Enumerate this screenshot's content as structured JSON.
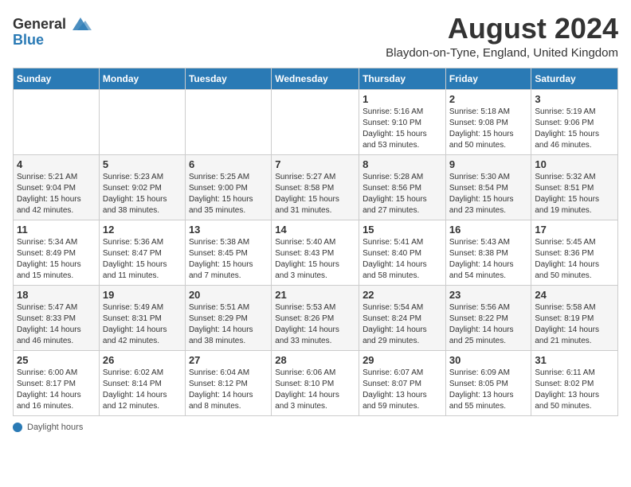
{
  "header": {
    "logo_general": "General",
    "logo_blue": "Blue",
    "month_year": "August 2024",
    "location": "Blaydon-on-Tyne, England, United Kingdom"
  },
  "calendar": {
    "days_of_week": [
      "Sunday",
      "Monday",
      "Tuesday",
      "Wednesday",
      "Thursday",
      "Friday",
      "Saturday"
    ],
    "weeks": [
      [
        {
          "day": "",
          "info": ""
        },
        {
          "day": "",
          "info": ""
        },
        {
          "day": "",
          "info": ""
        },
        {
          "day": "",
          "info": ""
        },
        {
          "day": "1",
          "info": "Sunrise: 5:16 AM\nSunset: 9:10 PM\nDaylight: 15 hours\nand 53 minutes."
        },
        {
          "day": "2",
          "info": "Sunrise: 5:18 AM\nSunset: 9:08 PM\nDaylight: 15 hours\nand 50 minutes."
        },
        {
          "day": "3",
          "info": "Sunrise: 5:19 AM\nSunset: 9:06 PM\nDaylight: 15 hours\nand 46 minutes."
        }
      ],
      [
        {
          "day": "4",
          "info": "Sunrise: 5:21 AM\nSunset: 9:04 PM\nDaylight: 15 hours\nand 42 minutes."
        },
        {
          "day": "5",
          "info": "Sunrise: 5:23 AM\nSunset: 9:02 PM\nDaylight: 15 hours\nand 38 minutes."
        },
        {
          "day": "6",
          "info": "Sunrise: 5:25 AM\nSunset: 9:00 PM\nDaylight: 15 hours\nand 35 minutes."
        },
        {
          "day": "7",
          "info": "Sunrise: 5:27 AM\nSunset: 8:58 PM\nDaylight: 15 hours\nand 31 minutes."
        },
        {
          "day": "8",
          "info": "Sunrise: 5:28 AM\nSunset: 8:56 PM\nDaylight: 15 hours\nand 27 minutes."
        },
        {
          "day": "9",
          "info": "Sunrise: 5:30 AM\nSunset: 8:54 PM\nDaylight: 15 hours\nand 23 minutes."
        },
        {
          "day": "10",
          "info": "Sunrise: 5:32 AM\nSunset: 8:51 PM\nDaylight: 15 hours\nand 19 minutes."
        }
      ],
      [
        {
          "day": "11",
          "info": "Sunrise: 5:34 AM\nSunset: 8:49 PM\nDaylight: 15 hours\nand 15 minutes."
        },
        {
          "day": "12",
          "info": "Sunrise: 5:36 AM\nSunset: 8:47 PM\nDaylight: 15 hours\nand 11 minutes."
        },
        {
          "day": "13",
          "info": "Sunrise: 5:38 AM\nSunset: 8:45 PM\nDaylight: 15 hours\nand 7 minutes."
        },
        {
          "day": "14",
          "info": "Sunrise: 5:40 AM\nSunset: 8:43 PM\nDaylight: 15 hours\nand 3 minutes."
        },
        {
          "day": "15",
          "info": "Sunrise: 5:41 AM\nSunset: 8:40 PM\nDaylight: 14 hours\nand 58 minutes."
        },
        {
          "day": "16",
          "info": "Sunrise: 5:43 AM\nSunset: 8:38 PM\nDaylight: 14 hours\nand 54 minutes."
        },
        {
          "day": "17",
          "info": "Sunrise: 5:45 AM\nSunset: 8:36 PM\nDaylight: 14 hours\nand 50 minutes."
        }
      ],
      [
        {
          "day": "18",
          "info": "Sunrise: 5:47 AM\nSunset: 8:33 PM\nDaylight: 14 hours\nand 46 minutes."
        },
        {
          "day": "19",
          "info": "Sunrise: 5:49 AM\nSunset: 8:31 PM\nDaylight: 14 hours\nand 42 minutes."
        },
        {
          "day": "20",
          "info": "Sunrise: 5:51 AM\nSunset: 8:29 PM\nDaylight: 14 hours\nand 38 minutes."
        },
        {
          "day": "21",
          "info": "Sunrise: 5:53 AM\nSunset: 8:26 PM\nDaylight: 14 hours\nand 33 minutes."
        },
        {
          "day": "22",
          "info": "Sunrise: 5:54 AM\nSunset: 8:24 PM\nDaylight: 14 hours\nand 29 minutes."
        },
        {
          "day": "23",
          "info": "Sunrise: 5:56 AM\nSunset: 8:22 PM\nDaylight: 14 hours\nand 25 minutes."
        },
        {
          "day": "24",
          "info": "Sunrise: 5:58 AM\nSunset: 8:19 PM\nDaylight: 14 hours\nand 21 minutes."
        }
      ],
      [
        {
          "day": "25",
          "info": "Sunrise: 6:00 AM\nSunset: 8:17 PM\nDaylight: 14 hours\nand 16 minutes."
        },
        {
          "day": "26",
          "info": "Sunrise: 6:02 AM\nSunset: 8:14 PM\nDaylight: 14 hours\nand 12 minutes."
        },
        {
          "day": "27",
          "info": "Sunrise: 6:04 AM\nSunset: 8:12 PM\nDaylight: 14 hours\nand 8 minutes."
        },
        {
          "day": "28",
          "info": "Sunrise: 6:06 AM\nSunset: 8:10 PM\nDaylight: 14 hours\nand 3 minutes."
        },
        {
          "day": "29",
          "info": "Sunrise: 6:07 AM\nSunset: 8:07 PM\nDaylight: 13 hours\nand 59 minutes."
        },
        {
          "day": "30",
          "info": "Sunrise: 6:09 AM\nSunset: 8:05 PM\nDaylight: 13 hours\nand 55 minutes."
        },
        {
          "day": "31",
          "info": "Sunrise: 6:11 AM\nSunset: 8:02 PM\nDaylight: 13 hours\nand 50 minutes."
        }
      ]
    ]
  },
  "footer": {
    "daylight_label": "Daylight hours"
  }
}
